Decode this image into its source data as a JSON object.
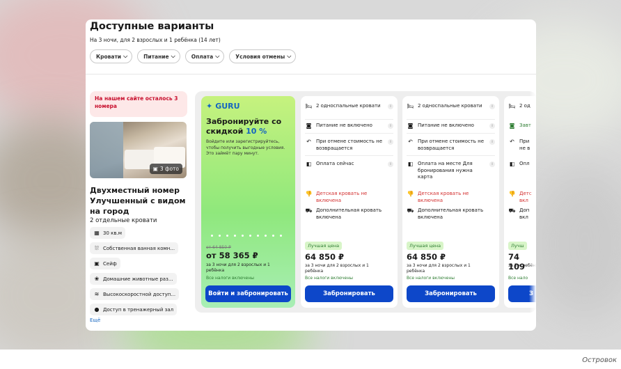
{
  "header": {
    "title": "Доступные варианты",
    "subtitle": "На 3 ночи, для 2 взрослых и 1 ребёнка (14 лет)"
  },
  "filters": [
    {
      "label": "Кровати"
    },
    {
      "label": "Питание"
    },
    {
      "label": "Оплата"
    },
    {
      "label": "Условия отмены"
    }
  ],
  "room": {
    "warning": "На нашем сайте осталось 3 номера",
    "photo_count": "3 фото",
    "name": "Двухместный номер Улучшенный с видом на город",
    "beds": "2 отдельные кровати",
    "amenities": [
      {
        "icon": "area-icon",
        "label": "30 кв.м"
      },
      {
        "icon": "bath-icon",
        "label": "Собственная ванная комн..."
      },
      {
        "icon": "safe-icon",
        "label": "Сейф"
      },
      {
        "icon": "paw-icon",
        "label": "Домашние животные раз..."
      },
      {
        "icon": "wifi-icon",
        "label": "Высокоскоростной доступ..."
      },
      {
        "icon": "gym-icon",
        "label": "Доступ в тренажерный зал"
      }
    ],
    "more": "Ещё"
  },
  "guru": {
    "logo": "GURU",
    "title_main": "Забронируйте со скидкой",
    "title_pct": "10 %",
    "text": "Войдите или зарегистрируйтесь, чтобы получить выгодные условия. Это займёт пару минут.",
    "old_price": "от 64 850 ₽",
    "price": "от 58 365 ₽",
    "note": "за 3 ночи для 2 взрослых и 1 ребёнка",
    "tax": "Все налоги включены",
    "button": "Войти и забронировать"
  },
  "offers": [
    {
      "beds": "2 односпальные кровати",
      "meal": "Питание не включено",
      "cancel": "При отмене стоимость не возвращается",
      "payment": "Оплата сейчас",
      "child_bed": "Детская кровать не включена",
      "extra_bed": "Дополнительная кровать включена",
      "badge": "Лучшая цена",
      "price": "64 850 ₽",
      "note": "за 3 ночи для 2 взрослых и 1 ребёнка",
      "tax": "Все налоги включены",
      "button": "Забронировать"
    },
    {
      "beds": "2 односпальные кровати",
      "meal": "Питание не включено",
      "cancel": "При отмене стоимость не возвращается",
      "payment": "Оплата на месте Для бронирования нужна карта",
      "child_bed": "Детская кровать не включена",
      "extra_bed": "Дополнительная кровать включена",
      "badge": "Лучшая цена",
      "price": "64 850 ₽",
      "note": "за 3 ночи для 2 взрослых и 1 ребёнка",
      "tax": "Все налоги включены",
      "button": "Забронировать"
    },
    {
      "beds": "2 од",
      "meal": "Завт",
      "cancel": "При не в",
      "payment": "Опл",
      "child_bed": "Детс вкл",
      "extra_bed": "Доп вкл",
      "badge": "Лучш",
      "price": "74 109",
      "note": "за 3 н ребён",
      "tax": "Все нало",
      "button": "З"
    }
  ],
  "caption": "Островок"
}
